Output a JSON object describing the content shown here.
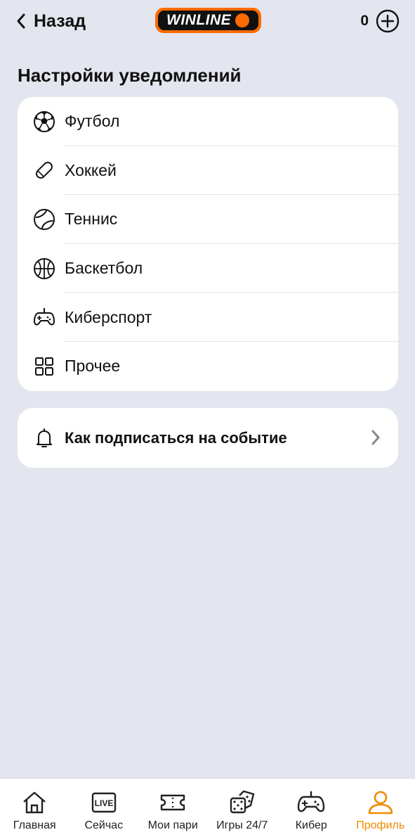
{
  "header": {
    "back_label": "Назад",
    "logo_text": "WINLINE",
    "balance": "0"
  },
  "colors": {
    "accent": "#ff6a00",
    "active_tab": "#f08a00",
    "background": "#e4e6ef"
  },
  "section_title": "Настройки уведомлений",
  "sports": [
    {
      "label": "Футбол",
      "icon": "soccer-ball-icon"
    },
    {
      "label": "Хоккей",
      "icon": "hockey-puck-icon"
    },
    {
      "label": "Теннис",
      "icon": "tennis-ball-icon"
    },
    {
      "label": "Баскетбол",
      "icon": "basketball-icon"
    },
    {
      "label": "Киберспорт",
      "icon": "gamepad-icon"
    },
    {
      "label": "Прочее",
      "icon": "grid-icon"
    }
  ],
  "subscribe": {
    "label": "Как подписаться на событие",
    "icon": "bell-icon"
  },
  "tabs": [
    {
      "label": "Главная",
      "icon": "home-icon",
      "active": false
    },
    {
      "label": "Сейчас",
      "icon": "live-icon",
      "active": false
    },
    {
      "label": "Мои пари",
      "icon": "ticket-icon",
      "active": false
    },
    {
      "label": "Игры 24/7",
      "icon": "dice-icon",
      "active": false
    },
    {
      "label": "Кибер",
      "icon": "gamepad-icon",
      "active": false
    },
    {
      "label": "Профиль",
      "icon": "profile-icon",
      "active": true
    }
  ]
}
